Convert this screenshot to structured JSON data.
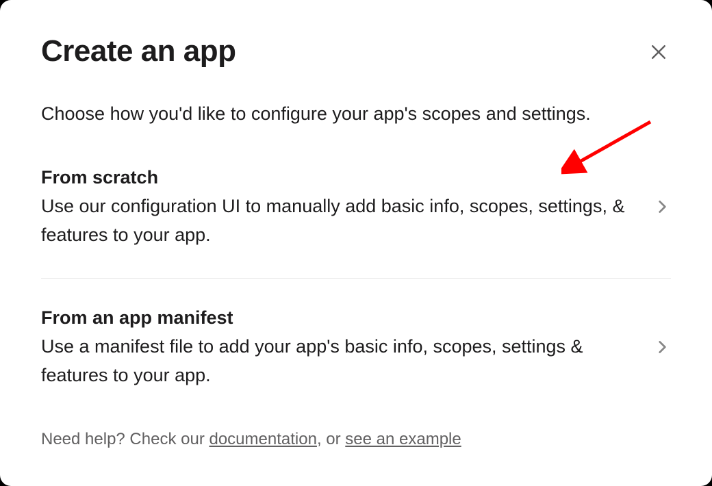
{
  "modal": {
    "title": "Create an app",
    "subtitle": "Choose how you'd like to configure your app's scopes and settings."
  },
  "options": [
    {
      "title": "From scratch",
      "description": "Use our configuration UI to manually add basic info, scopes, settings, & features to your app."
    },
    {
      "title": "From an app manifest",
      "description": "Use a manifest file to add your app's basic info, scopes, settings & features to your app."
    }
  ],
  "footer": {
    "prefix": "Need help? Check our ",
    "link1": "documentation",
    "middle": ", or ",
    "link2": "see an example"
  }
}
